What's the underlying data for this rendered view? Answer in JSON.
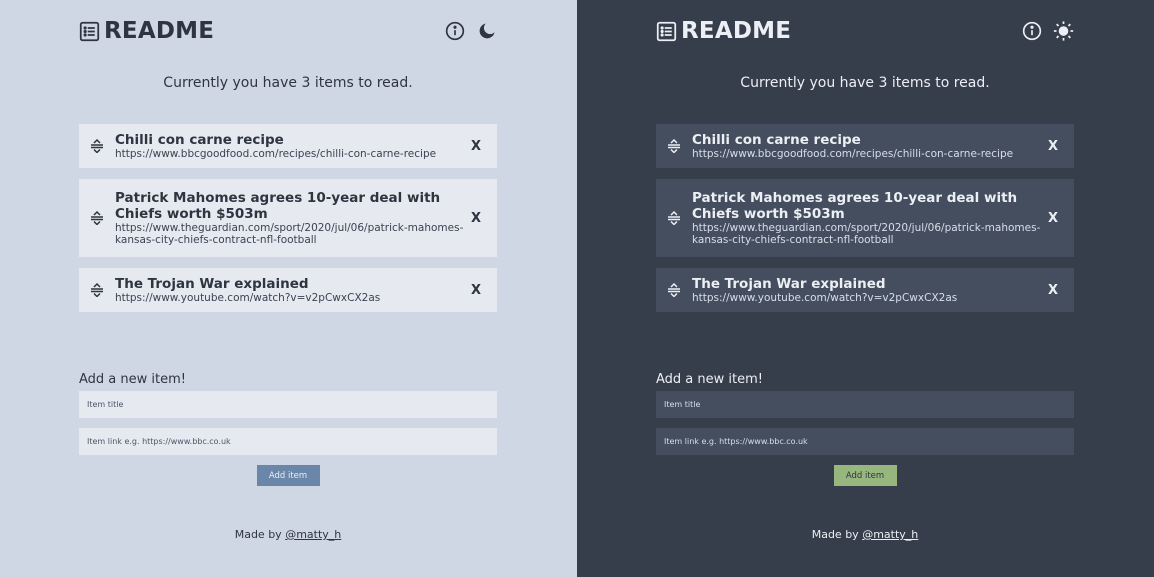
{
  "app": {
    "title": "README"
  },
  "summary": "Currently you have 3 items to read.",
  "items": [
    {
      "title": "Chilli con carne recipe",
      "url": "https://www.bbcgoodfood.com/recipes/chilli-con-carne-recipe",
      "remove": "X"
    },
    {
      "title": "Patrick Mahomes agrees 10-year deal with Chiefs worth $503m",
      "url": "https://www.theguardian.com/sport/2020/jul/06/patrick-mahomes-kansas-city-chiefs-contract-nfl-football",
      "remove": "X"
    },
    {
      "title": "The Trojan War explained",
      "url": "https://www.youtube.com/watch?v=v2pCwxCX2as",
      "remove": "X"
    }
  ],
  "form": {
    "label": "Add a new item!",
    "title_placeholder": "Item title",
    "link_placeholder": "Item link e.g. https://www.bbc.co.uk",
    "add_label": "Add item"
  },
  "footer": {
    "prefix": "Made by ",
    "author": "@matty_h"
  },
  "themes": {
    "light": {
      "background": "#d0d7e4",
      "card": "#e6e9f0",
      "button": "#6a87aa",
      "text": "#2e3440",
      "toggle_icon": "moon-icon"
    },
    "dark": {
      "background": "#363d4b",
      "card": "#454e5f",
      "button": "#98b77f",
      "text": "#eceff4",
      "toggle_icon": "sun-icon"
    }
  },
  "icons": {
    "brand": "list-icon",
    "info": "info-icon",
    "drag": "drag-handle-icon"
  }
}
